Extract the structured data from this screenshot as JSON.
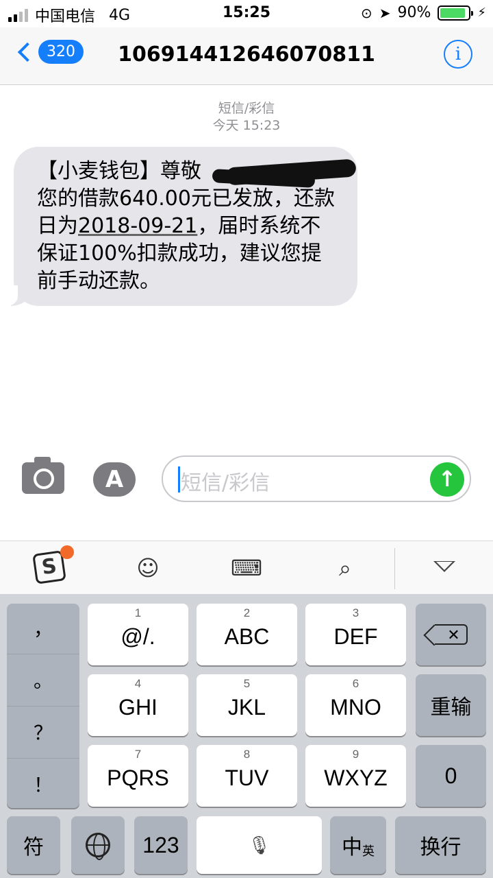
{
  "status_bar": {
    "carrier": "中国电信",
    "network": "4G",
    "time": "15:25",
    "battery": "90%",
    "battery_level": 0.9,
    "icons": [
      "signal-icon",
      "orientation-lock-icon",
      "location-icon",
      "battery-icon",
      "charging-icon"
    ]
  },
  "nav": {
    "back_badge": "320",
    "title": "106914412646070811",
    "info_glyph": "i"
  },
  "thread": {
    "meta_type": "短信/彩信",
    "meta_time": "今天 15:23",
    "message": {
      "part1": "【小麦钱包】尊敬",
      "part2": "您的借款640.00元已发放，还款日为",
      "date": "2018-09-21",
      "part3": "，届时系统不保证100%扣款成功，建议您提前手动还款。"
    }
  },
  "input": {
    "placeholder": "短信/彩信"
  },
  "keyboard": {
    "punct": [
      "，",
      "。",
      "？",
      "！"
    ],
    "rows": [
      [
        {
          "num": "1",
          "label": "@/."
        },
        {
          "num": "2",
          "label": "ABC"
        },
        {
          "num": "3",
          "label": "DEF"
        }
      ],
      [
        {
          "num": "4",
          "label": "GHI"
        },
        {
          "num": "5",
          "label": "JKL"
        },
        {
          "num": "6",
          "label": "MNO"
        }
      ],
      [
        {
          "num": "7",
          "label": "PQRS"
        },
        {
          "num": "8",
          "label": "TUV"
        },
        {
          "num": "9",
          "label": "WXYZ"
        }
      ]
    ],
    "retype": "重输",
    "zero": "0",
    "symbols": "符",
    "numbers": "123",
    "lang_main": "中",
    "lang_sub": "英",
    "enter": "换行"
  }
}
